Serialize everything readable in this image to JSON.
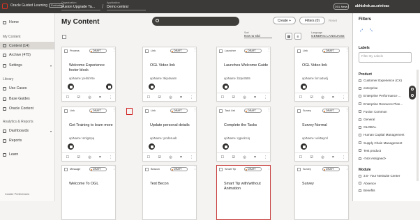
{
  "topbar": {
    "brand": "Oracle Guided Learning",
    "brand_tag": "Evaluate",
    "org_label": "Organization",
    "org_value": "Fusion Upgrade Ta...",
    "app_label": "Application",
    "app_value": "Demo central",
    "ogl_news": "OGL News",
    "user": "abhishek.as.srinivas"
  },
  "sidebar": {
    "home": "Home",
    "my_content_head": "My Content",
    "content": "Content (14)",
    "archive": "Archive (475)",
    "settings": "Settings",
    "library_head": "Library",
    "use_cases": "Use Cases",
    "base_guides": "Base Guides",
    "oracle_content": "Oracle Content",
    "analytics_head": "Analytics & Reports",
    "dashboards": "Dashboards",
    "reports": "Reports",
    "learn": "Learn",
    "cookie": "Cookie Preferences"
  },
  "main": {
    "title": "My Content",
    "search_placeholder": "",
    "create": "Create +",
    "filters": "Filters (0)",
    "reset": "Reset",
    "sort_label": "Sort",
    "sort_value": "New to Old",
    "lang_label": "Language",
    "lang_value": "GENERIC LANGUAGE"
  },
  "cards": [
    {
      "type": "Process",
      "status": "DRAFT",
      "title": "Welcome Experience footer block",
      "api": "apiName: pei0dY6e"
    },
    {
      "type": "Link",
      "status": "DRAFT",
      "title": "OGL Video link",
      "api": "apiName: 9kp4warm"
    },
    {
      "type": "Launcher",
      "status": "DRAFT",
      "title": "Launches Welcome Guide",
      "api": "apiName: b2pe3555"
    },
    {
      "type": "Link",
      "status": "DRAFT",
      "title": "OGL Video link",
      "api": "apiName: km:a4wdj"
    },
    {
      "type": "Link",
      "status": "DRAFT",
      "title": "Get Training to learn more",
      "api": "apiName: smlgmpq"
    },
    {
      "type": "Link",
      "status": "DRAFT",
      "title": "Update personal details",
      "api": "apiName: ytodnsuab"
    },
    {
      "type": "Task List",
      "status": "DRAFT",
      "title": "Complete the Tasks",
      "api": "apiName: rgpvdcciq"
    },
    {
      "type": "Survey",
      "status": "DRAFT",
      "title": "Survey Normal",
      "api": "apiName: vek5ayml"
    },
    {
      "type": "Message",
      "status": "DRAFT",
      "title": "Welcome To OGL",
      "api": ""
    },
    {
      "type": "Beacon",
      "status": "DRAFT",
      "title": "Test Becon",
      "api": ""
    },
    {
      "type": "Smart Tip",
      "status": "DRAFT",
      "title": "Smart Tip with/without Animation",
      "api": ""
    },
    {
      "type": "Survey",
      "status": "DRAFT",
      "title": "Survey",
      "api": ""
    }
  ],
  "filters": {
    "title": "Filters",
    "labels_head": "Labels",
    "filter_placeholder": "Filter By Labels",
    "product_head": "Product",
    "products": [
      "Customer Experience (CX)",
      "enterprise",
      "Enterprise Performance ...",
      "Enterprise Resource Plan...",
      "Fusion Common",
      "General",
      "GLOBAL",
      "Human Capital Management",
      "Supply Chain Management",
      "Test product",
      "<Not Assigned>"
    ],
    "module_head": "Module",
    "modules": [
      "3.0- Your NetSuite Center",
      "Absence",
      "Benefits"
    ]
  }
}
